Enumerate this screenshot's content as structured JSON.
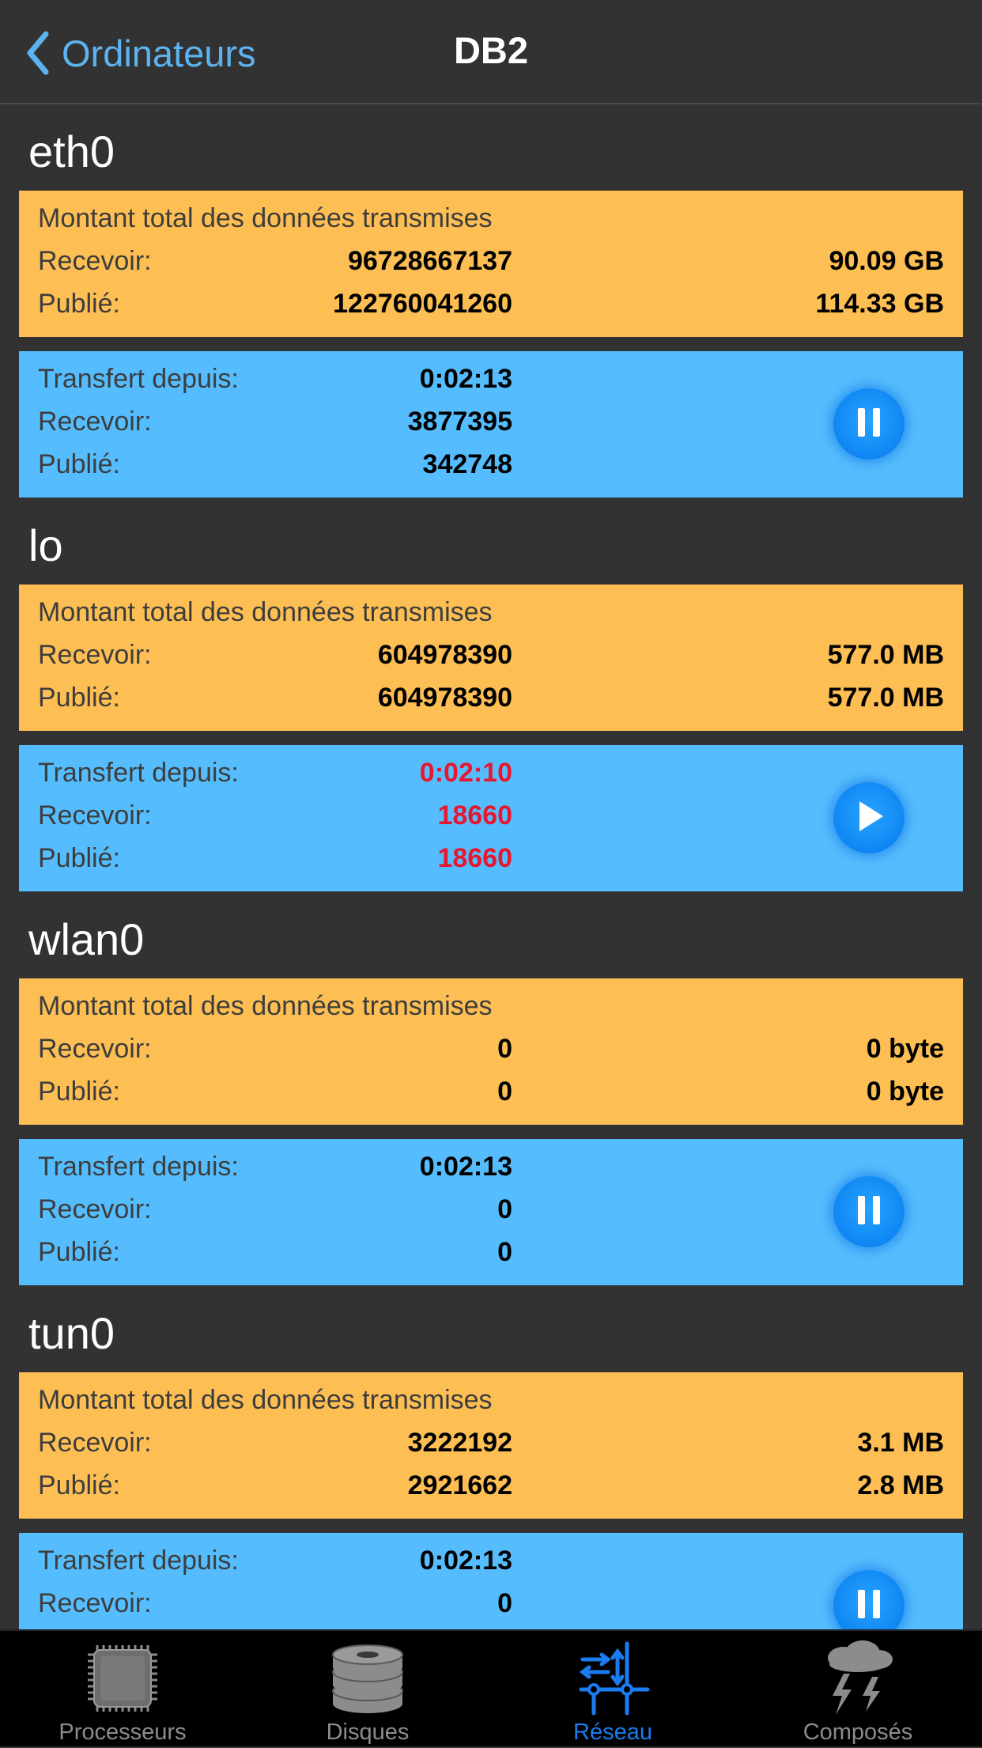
{
  "nav": {
    "back_label": "Ordinateurs",
    "title": "DB2"
  },
  "labels": {
    "total_header": "Montant total des données transmises",
    "receive": "Recevoir:",
    "sent": "Publié:",
    "since": "Transfert depuis:"
  },
  "interfaces": [
    {
      "name": "eth0",
      "total": {
        "receive": "96728667137",
        "receive_size": "90.09 GB",
        "sent": "122760041260",
        "sent_size": "114.33 GB"
      },
      "rate": {
        "since": "0:02:13",
        "receive": "3877395",
        "sent": "342748",
        "state": "paused",
        "highlight": false,
        "button_icon": "pause-icon"
      }
    },
    {
      "name": "lo",
      "total": {
        "receive": "604978390",
        "receive_size": "577.0 MB",
        "sent": "604978390",
        "sent_size": "577.0 MB"
      },
      "rate": {
        "since": "0:02:10",
        "receive": "18660",
        "sent": "18660",
        "state": "playing",
        "highlight": true,
        "button_icon": "play-icon"
      }
    },
    {
      "name": "wlan0",
      "total": {
        "receive": "0",
        "receive_size": "0 byte",
        "sent": "0",
        "sent_size": "0 byte"
      },
      "rate": {
        "since": "0:02:13",
        "receive": "0",
        "sent": "0",
        "state": "paused",
        "highlight": false,
        "button_icon": "pause-icon"
      }
    },
    {
      "name": "tun0",
      "total": {
        "receive": "3222192",
        "receive_size": "3.1 MB",
        "sent": "2921662",
        "sent_size": "2.8 MB"
      },
      "rate": {
        "since": "0:02:13",
        "receive": "0",
        "state": "paused",
        "highlight": false,
        "button_icon": "pause-icon"
      }
    }
  ],
  "tabs": [
    {
      "label": "Processeurs",
      "icon": "cpu-chip-icon",
      "active": false
    },
    {
      "label": "Disques",
      "icon": "disk-stack-icon",
      "active": false
    },
    {
      "label": "Réseau",
      "icon": "network-icon",
      "active": true
    },
    {
      "label": "Composés",
      "icon": "storm-cloud-icon",
      "active": false
    }
  ],
  "colors": {
    "background": "#323232",
    "total_card": "#fdbf53",
    "rate_card": "#55bdfd",
    "accent_blue": "#1a7cf0",
    "highlight_red": "#e8162e",
    "back_link": "#5cb3ef"
  }
}
